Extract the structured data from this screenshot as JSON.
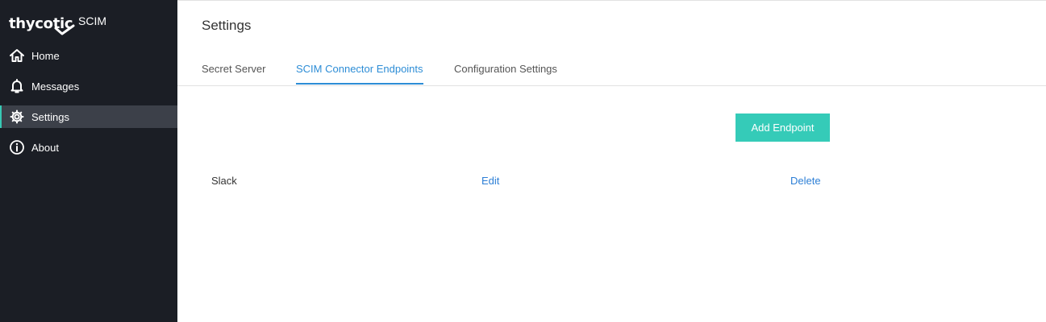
{
  "sidebar": {
    "brand": {
      "logo_text": "thycotic",
      "product": "SCIM"
    },
    "items": [
      {
        "label": "Home",
        "icon": "home-icon"
      },
      {
        "label": "Messages",
        "icon": "bell-icon"
      },
      {
        "label": "Settings",
        "icon": "gear-icon",
        "active": true
      },
      {
        "label": "About",
        "icon": "info-icon"
      }
    ]
  },
  "main": {
    "title": "Settings",
    "tabs": [
      {
        "label": "Secret Server"
      },
      {
        "label": "SCIM Connector Endpoints",
        "active": true
      },
      {
        "label": "Configuration Settings"
      }
    ],
    "add_button_label": "Add Endpoint",
    "endpoints": [
      {
        "name": "Slack",
        "edit_label": "Edit",
        "delete_label": "Delete"
      }
    ]
  },
  "colors": {
    "sidebar_bg": "#1b1e25",
    "accent": "#35cbb8",
    "link": "#2d8dd6"
  }
}
